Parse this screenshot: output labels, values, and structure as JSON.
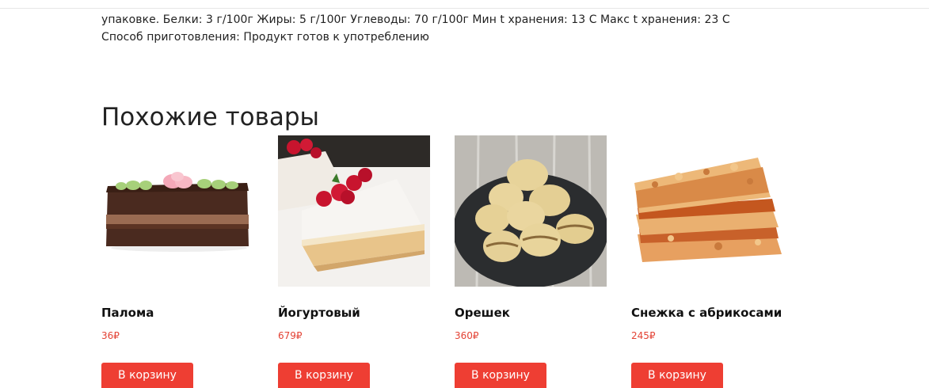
{
  "description": {
    "line1": "упаковке. Белки: 3 г/100г Жиры: 5 г/100г Углеводы: 70 г/100г Мин t хранения: 13 С Макс t хранения: 23 С",
    "line2": "Способ приготовления: Продукт готов к употреблению"
  },
  "similar": {
    "title": "Похожие товары",
    "products": [
      {
        "name": "Палома",
        "price": "36₽",
        "button": "В корзину",
        "image": "layered-chocolate-cake-slice"
      },
      {
        "name": "Йогуртовый",
        "price": "679₽",
        "button": "В корзину",
        "image": "yogurt-cheesecake-with-raspberries"
      },
      {
        "name": "Орешек",
        "price": "360₽",
        "button": "В корзину",
        "image": "walnut-shaped-cookies-on-slate"
      },
      {
        "name": "Снежка с абрикосами",
        "price": "245₽",
        "button": "В корзину",
        "image": "apricot-crumble-bars"
      }
    ]
  },
  "colors": {
    "accent": "#ee3e33",
    "price": "#e34234"
  }
}
